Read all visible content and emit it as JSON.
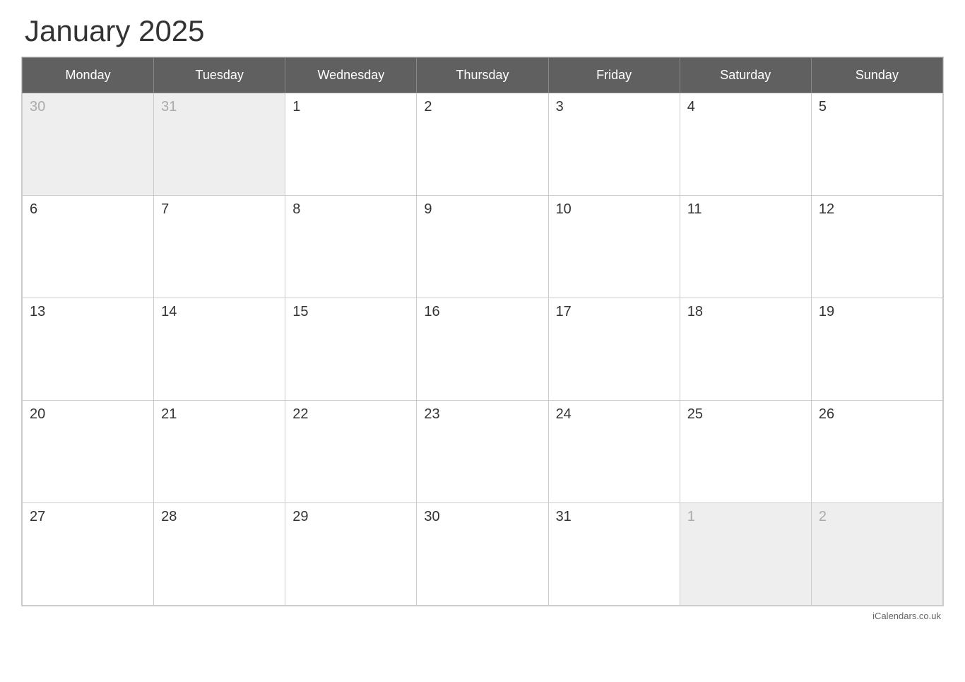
{
  "header": {
    "title": "January 2025"
  },
  "weekdays": [
    "Monday",
    "Tuesday",
    "Wednesday",
    "Thursday",
    "Friday",
    "Saturday",
    "Sunday"
  ],
  "weeks": [
    [
      {
        "day": "30",
        "outside": true
      },
      {
        "day": "31",
        "outside": true
      },
      {
        "day": "1",
        "outside": false
      },
      {
        "day": "2",
        "outside": false
      },
      {
        "day": "3",
        "outside": false
      },
      {
        "day": "4",
        "outside": false
      },
      {
        "day": "5",
        "outside": false
      }
    ],
    [
      {
        "day": "6",
        "outside": false
      },
      {
        "day": "7",
        "outside": false
      },
      {
        "day": "8",
        "outside": false
      },
      {
        "day": "9",
        "outside": false
      },
      {
        "day": "10",
        "outside": false
      },
      {
        "day": "11",
        "outside": false
      },
      {
        "day": "12",
        "outside": false
      }
    ],
    [
      {
        "day": "13",
        "outside": false
      },
      {
        "day": "14",
        "outside": false
      },
      {
        "day": "15",
        "outside": false
      },
      {
        "day": "16",
        "outside": false
      },
      {
        "day": "17",
        "outside": false
      },
      {
        "day": "18",
        "outside": false
      },
      {
        "day": "19",
        "outside": false
      }
    ],
    [
      {
        "day": "20",
        "outside": false
      },
      {
        "day": "21",
        "outside": false
      },
      {
        "day": "22",
        "outside": false
      },
      {
        "day": "23",
        "outside": false
      },
      {
        "day": "24",
        "outside": false
      },
      {
        "day": "25",
        "outside": false
      },
      {
        "day": "26",
        "outside": false
      }
    ],
    [
      {
        "day": "27",
        "outside": false
      },
      {
        "day": "28",
        "outside": false
      },
      {
        "day": "29",
        "outside": false
      },
      {
        "day": "30",
        "outside": false
      },
      {
        "day": "31",
        "outside": false
      },
      {
        "day": "1",
        "outside": true
      },
      {
        "day": "2",
        "outside": true
      }
    ]
  ],
  "footer": {
    "text": "iCalendars.co.uk"
  }
}
